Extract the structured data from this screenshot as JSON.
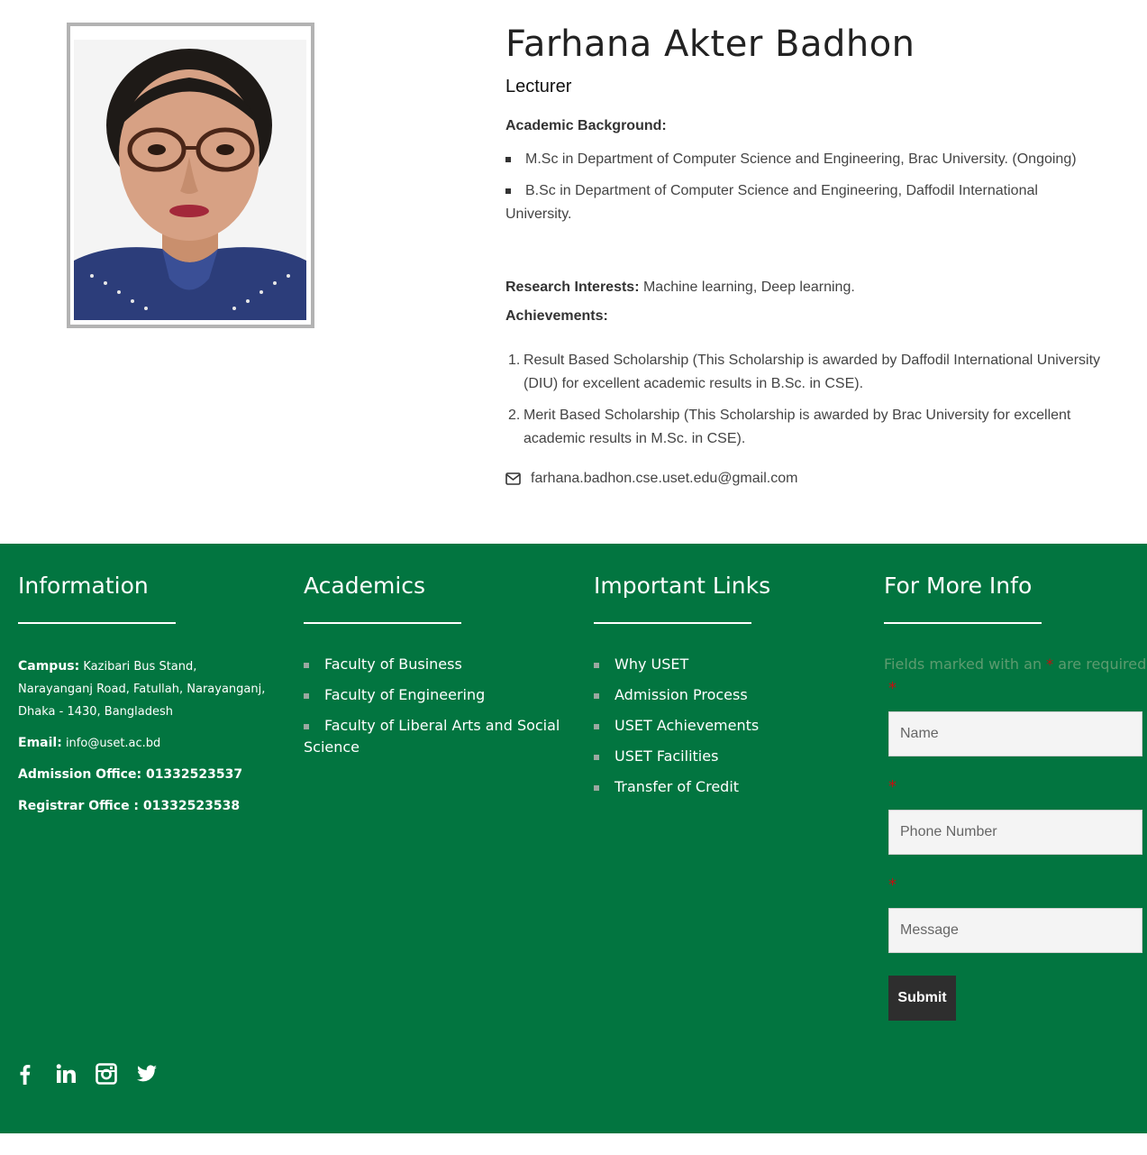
{
  "profile": {
    "name": "Farhana Akter Badhon",
    "designation": "Lecturer",
    "academic_label": "Academic Background:",
    "academic": [
      "M.Sc in Department of Computer Science and Engineering, Brac University. (Ongoing)",
      "B.Sc in Department of Computer Science and Engineering, Daffodil International University."
    ],
    "research_label": "Research Interests:",
    "research_value": "Machine learning, Deep learning.",
    "achievements_label": "Achievements:",
    "achievements": [
      "Result Based Scholarship (This Scholarship is awarded by Daffodil International University (DIU) for excellent academic results in B.Sc. in CSE).",
      "Merit Based Scholarship (This Scholarship is awarded by Brac University for excellent academic results in M.Sc. in CSE)."
    ],
    "achievement_numbers": [
      "1.",
      "2."
    ],
    "email": "farhana.badhon.cse.uset.edu@gmail.com",
    "email_icon": "envelope-icon"
  },
  "footer": {
    "background": "#027540",
    "information": {
      "title": "Information",
      "campus_label": "Campus:",
      "campus_value": "Kazibari Bus Stand, Narayanganj Road, Fatullah, Narayanganj, Dhaka - 1430, Bangladesh",
      "email_label": "Email:",
      "email_value": "info@uset.ac.bd",
      "admission": "Admission Office: 01332523537",
      "registrar": "Registrar Office : 01332523538"
    },
    "academics": {
      "title": "Academics",
      "items": [
        "Faculty of Business",
        "Faculty of Engineering",
        "Faculty of Liberal Arts and Social Science"
      ]
    },
    "important_links": {
      "title": "Important Links",
      "items": [
        "Why USET",
        "Admission Process",
        "USET Achievements",
        "USET Facilities",
        "Transfer of Credit"
      ]
    },
    "more_info": {
      "title": "For More Info",
      "note_prefix": "Fields marked with an",
      "note_star": "*",
      "note_suffix": "are required",
      "required_mark": "*",
      "name_placeholder": "Name",
      "phone_placeholder": "Phone Number",
      "message_placeholder": "Message",
      "submit_label": "Submit"
    },
    "social_icons": [
      "facebook-icon",
      "linkedin-icon",
      "instagram-icon",
      "twitter-icon"
    ]
  }
}
